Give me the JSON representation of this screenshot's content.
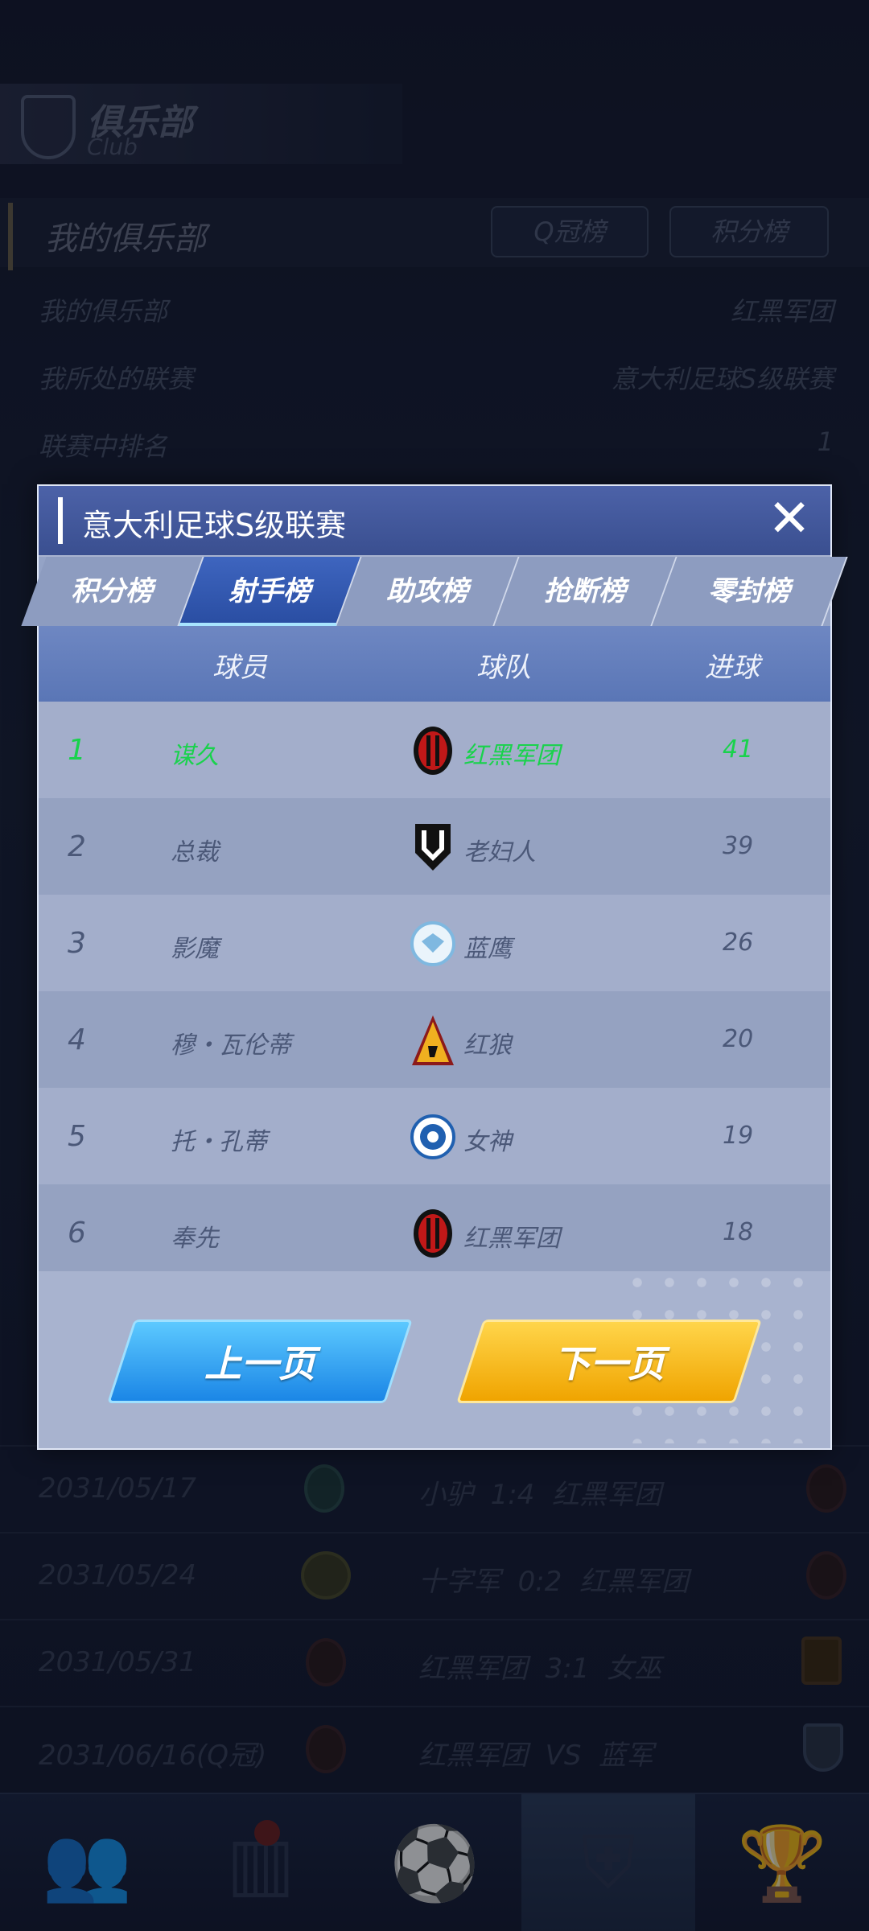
{
  "club_header": {
    "title": "俱乐部",
    "subtitle": "Club"
  },
  "section": {
    "title": "我的俱乐部",
    "pills": [
      "Q冠榜",
      "积分榜"
    ]
  },
  "info_rows": [
    {
      "label": "我的俱乐部",
      "value": "红黑军团"
    },
    {
      "label": "我所处的联赛",
      "value": "意大利足球S级联赛"
    },
    {
      "label": "联赛中排名",
      "value": "1"
    }
  ],
  "matches": [
    {
      "date": "2031/05/17",
      "result": "小驴  1:4  红黑军团"
    },
    {
      "date": "2031/05/24",
      "result": "十字军  0:2  红黑军团"
    },
    {
      "date": "2031/05/31",
      "result": "红黑军团  3:1  女巫"
    },
    {
      "date": "2031/06/16(Q冠)",
      "result": "红黑军团  VS  蓝军"
    }
  ],
  "modal": {
    "title": "意大利足球S级联赛",
    "close_icon": "close-icon",
    "tabs": [
      "积分榜",
      "射手榜",
      "助攻榜",
      "抢断榜",
      "零封榜"
    ],
    "active_tab": "射手榜",
    "columns": {
      "player": "球员",
      "team": "球队",
      "goals": "进球"
    },
    "rows": [
      {
        "rank": "1",
        "player": "谋久",
        "team": "红黑军团",
        "goals": "41",
        "highlight": true,
        "badge_color": "#c01818"
      },
      {
        "rank": "2",
        "player": "总裁",
        "team": "老妇人",
        "goals": "39",
        "highlight": false,
        "badge_color": "#111111"
      },
      {
        "rank": "3",
        "player": "影魔",
        "team": "蓝鹰",
        "goals": "26",
        "highlight": false,
        "badge_color": "#7fb8e0"
      },
      {
        "rank": "4",
        "player": "穆・瓦伦蒂",
        "team": "红狼",
        "goals": "20",
        "highlight": false,
        "badge_color": "#e0a020"
      },
      {
        "rank": "5",
        "player": "托・孔蒂",
        "team": "女神",
        "goals": "19",
        "highlight": false,
        "badge_color": "#2060b0"
      },
      {
        "rank": "6",
        "player": "奉先",
        "team": "红黑军团",
        "goals": "18",
        "highlight": false,
        "badge_color": "#c01818"
      }
    ],
    "prev_label": "上一页",
    "next_label": "下一页"
  },
  "colors": {
    "accent_blue": "#2a4ea3",
    "highlight_green": "#19d24c",
    "next_yellow": "#f0a400"
  }
}
